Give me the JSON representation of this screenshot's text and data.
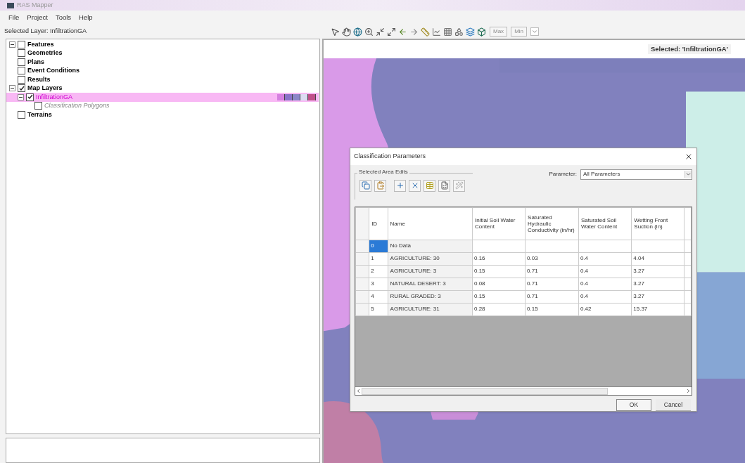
{
  "window": {
    "title": "RAS Mapper"
  },
  "menu": [
    "File",
    "Project",
    "Tools",
    "Help"
  ],
  "selected_layer_label": "Selected Layer: InfiltrationGA",
  "tree": [
    {
      "label": "Features",
      "kind": "group",
      "checked": false,
      "expanded": true,
      "selected": false
    },
    {
      "label": "Geometries",
      "kind": "group",
      "checked": false,
      "selected": false
    },
    {
      "label": "Plans",
      "kind": "group",
      "checked": false,
      "selected": false
    },
    {
      "label": "Event Conditions",
      "kind": "group",
      "checked": false,
      "selected": false
    },
    {
      "label": "Results",
      "kind": "group",
      "checked": false,
      "selected": false
    },
    {
      "label": "Map Layers",
      "kind": "group",
      "checked": true,
      "expanded": true,
      "selected": false,
      "children": [
        {
          "label": "InfiltrationGA",
          "kind": "layer",
          "checked": true,
          "expanded": true,
          "selected": true,
          "legend": [
            {
              "color": "#d580e0"
            },
            {
              "color": "#8a72c8"
            },
            {
              "color": "#8c86c8"
            },
            {
              "color": "#dcdcf2"
            },
            {
              "color": "#c0508a"
            }
          ],
          "children": [
            {
              "label": "Classification Polygons",
              "kind": "sublayer",
              "checked": false,
              "selected": false
            }
          ]
        }
      ]
    },
    {
      "label": "Terrains",
      "kind": "group",
      "checked": false,
      "selected": false
    }
  ],
  "toolbar": {
    "buttons": [
      {
        "label": "Max",
        "disabled": true
      },
      {
        "label": "Min",
        "disabled": true
      }
    ]
  },
  "map": {
    "selected_label": "Selected: 'InfiltrationGA'"
  },
  "dialog": {
    "title": "Classification Parameters",
    "group_label": "Selected Area Edits",
    "parameter_label": "Parameter:",
    "parameter_value": "All Parameters",
    "columns": [
      "ID",
      "Name",
      "Initial Soil Water Content",
      "Saturated Hydraulic Conductivity (in/hr)",
      "Saturated Soil Water Content",
      "Wetting Front Suction (in)"
    ],
    "rows": [
      {
        "id": "0",
        "name": "No Data",
        "selected": true
      },
      {
        "id": "1",
        "name": "AGRICULTURE: 30",
        "values": [
          "0.16",
          "0.03",
          "0.4",
          "4.04"
        ],
        "selected": false
      },
      {
        "id": "2",
        "name": "AGRICULTURE: 3",
        "values": [
          "0.15",
          "0.71",
          "0.4",
          "3.27"
        ],
        "selected": false
      },
      {
        "id": "3",
        "name": "NATURAL DESERT: 3",
        "values": [
          "0.08",
          "0.71",
          "0.4",
          "3.27"
        ],
        "selected": false
      },
      {
        "id": "4",
        "name": "RURAL GRADED: 3",
        "values": [
          "0.15",
          "0.71",
          "0.4",
          "3.27"
        ],
        "selected": false
      },
      {
        "id": "5",
        "name": "AGRICULTURE: 31",
        "values": [
          "0.28",
          "0.15",
          "0.42",
          "15.37"
        ],
        "selected": false
      }
    ],
    "buttons": [
      "OK",
      "Cancel"
    ]
  }
}
